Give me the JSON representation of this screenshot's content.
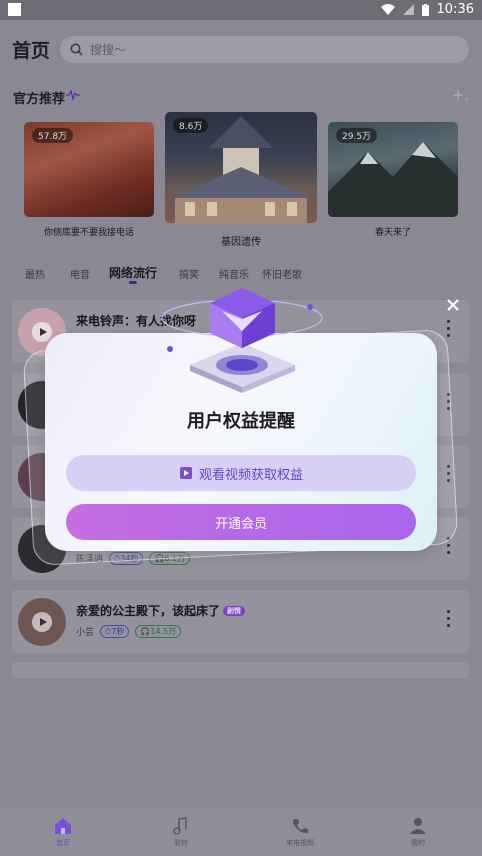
{
  "status": {
    "time": "10:36"
  },
  "header": {
    "title": "首页",
    "search_placeholder": "搜搜～"
  },
  "featured": {
    "title": "官方推荐",
    "items": [
      {
        "count": "57.8万",
        "caption": "你侧底要不要我接电话"
      },
      {
        "count": "8.6万",
        "caption": "基因遗传"
      },
      {
        "count": "29.5万",
        "caption": "春天来了"
      }
    ]
  },
  "tabs": [
    "最热",
    "电音",
    "网络流行",
    "搞笑",
    "纯音乐",
    "怀旧老歌"
  ],
  "songs": [
    {
      "title": "来电铃声：有人找你呀",
      "author": "",
      "duration": "",
      "plays": "",
      "tag": ""
    },
    {
      "title": "",
      "author": "",
      "duration": "",
      "plays": "",
      "tag": ""
    },
    {
      "title": "",
      "author": "",
      "duration": "",
      "plays": "",
      "tag": ""
    },
    {
      "title": "",
      "author": "陈泽逍",
      "duration": "34秒",
      "plays": "6.1万",
      "tag": ""
    },
    {
      "title": "亲爱的公主殿下，该起床了",
      "author": "小芸",
      "duration": "7秒",
      "plays": "14.5万",
      "tag": "剧情"
    }
  ],
  "nav": [
    {
      "label": "首页",
      "icon": "home-icon",
      "active": true
    },
    {
      "label": "彩铃",
      "icon": "music-note-icon",
      "active": false
    },
    {
      "label": "来电视频",
      "icon": "phone-icon",
      "active": false
    },
    {
      "label": "我的",
      "icon": "user-icon",
      "active": false
    }
  ],
  "dialog": {
    "title": "用户权益提醒",
    "watch_label": "观看视频获取权益",
    "vip_label": "开通会员"
  },
  "colors": {
    "accent": "#7a4fd6",
    "vip_gradient_start": "#c56ee2",
    "vip_gradient_end": "#a766ec"
  }
}
